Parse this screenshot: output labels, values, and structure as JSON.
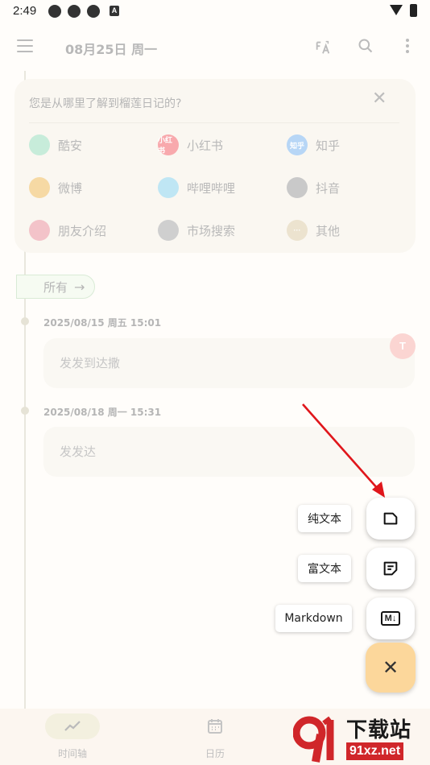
{
  "status_bar": {
    "time": "2:49",
    "notification_icons": [
      "app-icon",
      "app-icon",
      "app-icon",
      "a-icon"
    ]
  },
  "app_bar": {
    "title": "08月25日 周一",
    "icons": [
      "menu-icon",
      "translate-icon",
      "search-icon",
      "more-icon"
    ]
  },
  "survey": {
    "question": "您是从哪里了解到榴莲日记的?",
    "options": [
      {
        "label": "酷安",
        "icon": "coolapk-icon",
        "icon_text": "",
        "color": "#c7ecda"
      },
      {
        "label": "小红书",
        "icon": "xiaohongshu-icon",
        "icon_text": "小红书",
        "color": "#f8a9ad"
      },
      {
        "label": "知乎",
        "icon": "zhihu-icon",
        "icon_text": "知乎",
        "color": "#b7d6f6"
      },
      {
        "label": "微博",
        "icon": "weibo-icon",
        "icon_text": "",
        "color": "#f6d9a4"
      },
      {
        "label": "哔哩哔哩",
        "icon": "bilibili-icon",
        "icon_text": "",
        "color": "#bfe6f4"
      },
      {
        "label": "抖音",
        "icon": "douyin-icon",
        "icon_text": "",
        "color": "#c9c9c9"
      },
      {
        "label": "朋友介绍",
        "icon": "friends-icon",
        "icon_text": "",
        "color": "#f3c3c9"
      },
      {
        "label": "市场搜索",
        "icon": "search-icon",
        "icon_text": "",
        "color": "#cfcfcf"
      },
      {
        "label": "其他",
        "icon": "more-icon",
        "icon_text": "···",
        "color": "#ece3cf"
      }
    ]
  },
  "filter": {
    "label": "所有",
    "arrow": "→"
  },
  "entries": [
    {
      "date": "2025/08/15 周五 15:01",
      "text": "发发到达撒",
      "badge": "T"
    },
    {
      "date": "2025/08/18 周一 15:31",
      "text": "发发达"
    }
  ],
  "fab_menu": {
    "items": [
      {
        "label": "纯文本",
        "icon": "plain-text-icon"
      },
      {
        "label": "富文本",
        "icon": "rich-text-icon"
      },
      {
        "label": "Markdown",
        "icon": "markdown-icon",
        "icon_text": "M↓"
      }
    ],
    "close_symbol": "✕"
  },
  "bottom_nav": [
    {
      "label": "时间轴",
      "icon": "timeline-icon",
      "active": true
    },
    {
      "label": "日历",
      "icon": "calendar-icon",
      "active": false
    }
  ],
  "watermark": {
    "title": "下载站",
    "url": "91xz.net"
  },
  "colors": {
    "accent": "#fcd79b",
    "arrow": "#e0161b",
    "watermark_red": "#d0262a"
  }
}
